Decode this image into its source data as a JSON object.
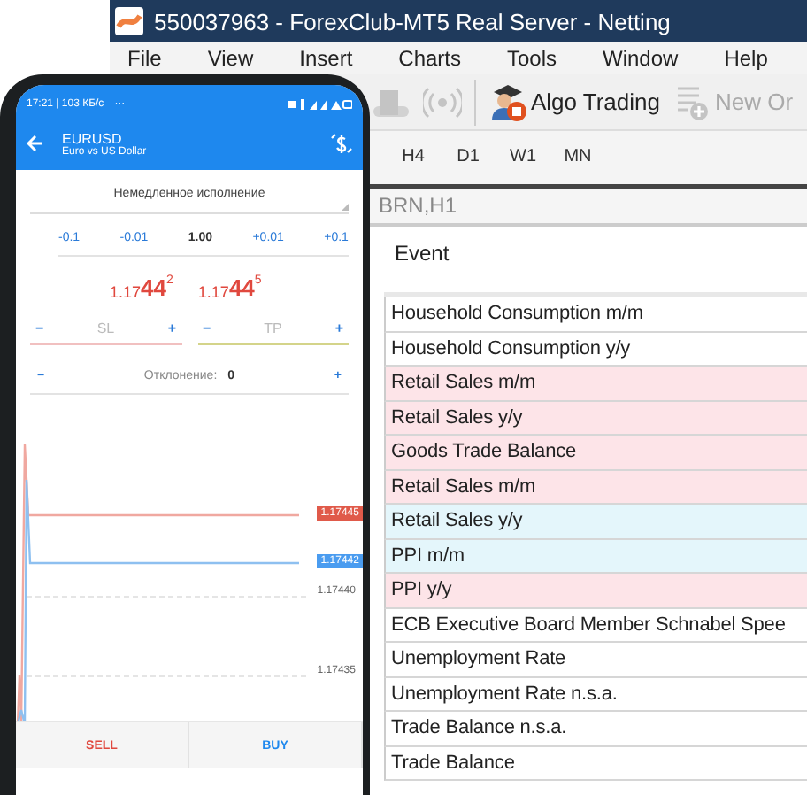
{
  "desktop_window": {
    "title": "550037963 - ForexClub-MT5 Real Server - Netting",
    "menu": [
      "File",
      "View",
      "Insert",
      "Charts",
      "Tools",
      "Window",
      "Help"
    ],
    "toolbar": [
      {
        "kind": "chart",
        "disabled": true
      },
      {
        "kind": "signal",
        "disabled": true
      },
      {
        "kind": "algo",
        "label": "Algo Trading",
        "disabled": false
      },
      {
        "kind": "order",
        "label": "New Or",
        "disabled": true
      }
    ],
    "timeframes": [
      {
        "label": "H4",
        "selected": false
      },
      {
        "label": "D1",
        "selected": false
      },
      {
        "label": "W1",
        "selected": false
      },
      {
        "label": "MN",
        "selected": false
      }
    ],
    "chart_tab": "BRN,H1",
    "calendar": {
      "columns": [
        "Event"
      ],
      "rows": [
        {
          "event": "Household Consumption m/m",
          "color": "#ffffff"
        },
        {
          "event": "Household Consumption y/y",
          "color": "#ffffff"
        },
        {
          "event": "Retail Sales m/m",
          "color": "#fde4e8"
        },
        {
          "event": "Retail Sales y/y",
          "color": "#fde4e8"
        },
        {
          "event": "Goods Trade Balance",
          "color": "#fde4e8"
        },
        {
          "event": "Retail Sales m/m",
          "color": "#fde4e8"
        },
        {
          "event": "Retail Sales y/y",
          "color": "#e4f6fb"
        },
        {
          "event": "PPI m/m",
          "color": "#e4f6fb"
        },
        {
          "event": "PPI y/y",
          "color": "#fde4e8"
        },
        {
          "event": "ECB Executive Board Member Schnabel Spee",
          "color": "#ffffff"
        },
        {
          "event": "Unemployment Rate",
          "color": "#ffffff"
        },
        {
          "event": "Unemployment Rate n.s.a.",
          "color": "#ffffff"
        },
        {
          "event": "Trade Balance n.s.a.",
          "color": "#ffffff"
        },
        {
          "event": "Trade Balance",
          "color": "#ffffff"
        }
      ]
    }
  },
  "phone": {
    "status_time": "17:21 | 103 КБ/с",
    "status_more": "···",
    "symbol": "EURUSD",
    "description": "Euro vs US Dollar",
    "execution": "Немедленное исполнение",
    "volume": [
      {
        "kind": "step",
        "label": "-0.1"
      },
      {
        "kind": "step",
        "label": "-0.01"
      },
      {
        "kind": "value",
        "label": "1.00"
      },
      {
        "kind": "step",
        "label": "+0.01"
      },
      {
        "kind": "step",
        "label": "+0.1"
      }
    ],
    "prices": [
      {
        "prefix": "1.17",
        "big": "44",
        "sup": "2"
      },
      {
        "prefix": "1.17",
        "big": "44",
        "sup": "5"
      }
    ],
    "levels": [
      {
        "label": "SL",
        "minus": "−",
        "plus": "+",
        "kind": "sl"
      },
      {
        "label": "TP",
        "minus": "−",
        "plus": "+",
        "kind": "tp"
      }
    ],
    "deviation": {
      "minus": "−",
      "label": "Отклонение:",
      "value": "0",
      "plus": "+"
    },
    "chart": {
      "ask_label": "1.17445",
      "bid_label": "1.17442",
      "grid_labels": [
        "1.17440",
        "1.17435"
      ]
    },
    "actions": [
      {
        "kind": "sell",
        "label": "SELL"
      },
      {
        "kind": "buy",
        "label": "BUY"
      }
    ]
  }
}
